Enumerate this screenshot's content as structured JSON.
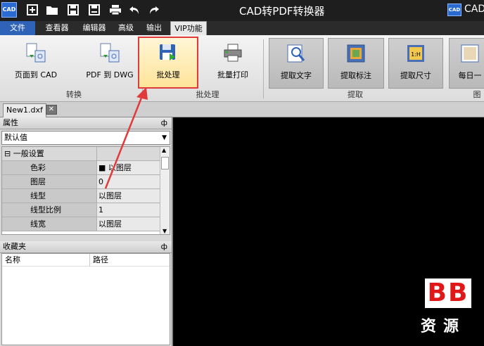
{
  "titlebar": {
    "app_icon_text": "CAD",
    "title": "CAD转PDF转换器",
    "right_icon_text": "CAD",
    "right_text": "CAD"
  },
  "menu": {
    "tabs": [
      "文件",
      "查看器",
      "编辑器",
      "高级",
      "输出",
      "VIP功能"
    ],
    "active": "VIP功能"
  },
  "ribbon": {
    "buttons": {
      "page_to_cad": "页面到 CAD",
      "pdf_to_dwg": "PDF 到 DWG",
      "batch": "批处理",
      "batch_print": "批量打印",
      "extract_text": "提取文字",
      "extract_annotation": "提取标注",
      "extract_size": "提取尺寸",
      "daily": "每日一"
    },
    "groups": {
      "convert": "转换",
      "batch": "批处理",
      "extract": "提取",
      "cut": "图"
    }
  },
  "document": {
    "tab": "New1.dxf"
  },
  "properties": {
    "header": "属性",
    "pin": "ф",
    "dropdown_value": "默认值",
    "category": "⊟ 一般设置",
    "rows": [
      {
        "key": "色彩",
        "value": "■ 以图层"
      },
      {
        "key": "图层",
        "value": "0"
      },
      {
        "key": "线型",
        "value": "以图层"
      },
      {
        "key": "线型比例",
        "value": "1"
      },
      {
        "key": "线宽",
        "value": "以图层"
      }
    ]
  },
  "favorites": {
    "header": "收藏夹",
    "pin": "ф",
    "col_name": "名称",
    "col_path": "路径"
  },
  "watermark": {
    "bb": "BB",
    "zy": "资源"
  },
  "colors": {
    "annotation": "#e03a3a",
    "file_tab": "#2f63b8",
    "canvas": "#000000"
  }
}
